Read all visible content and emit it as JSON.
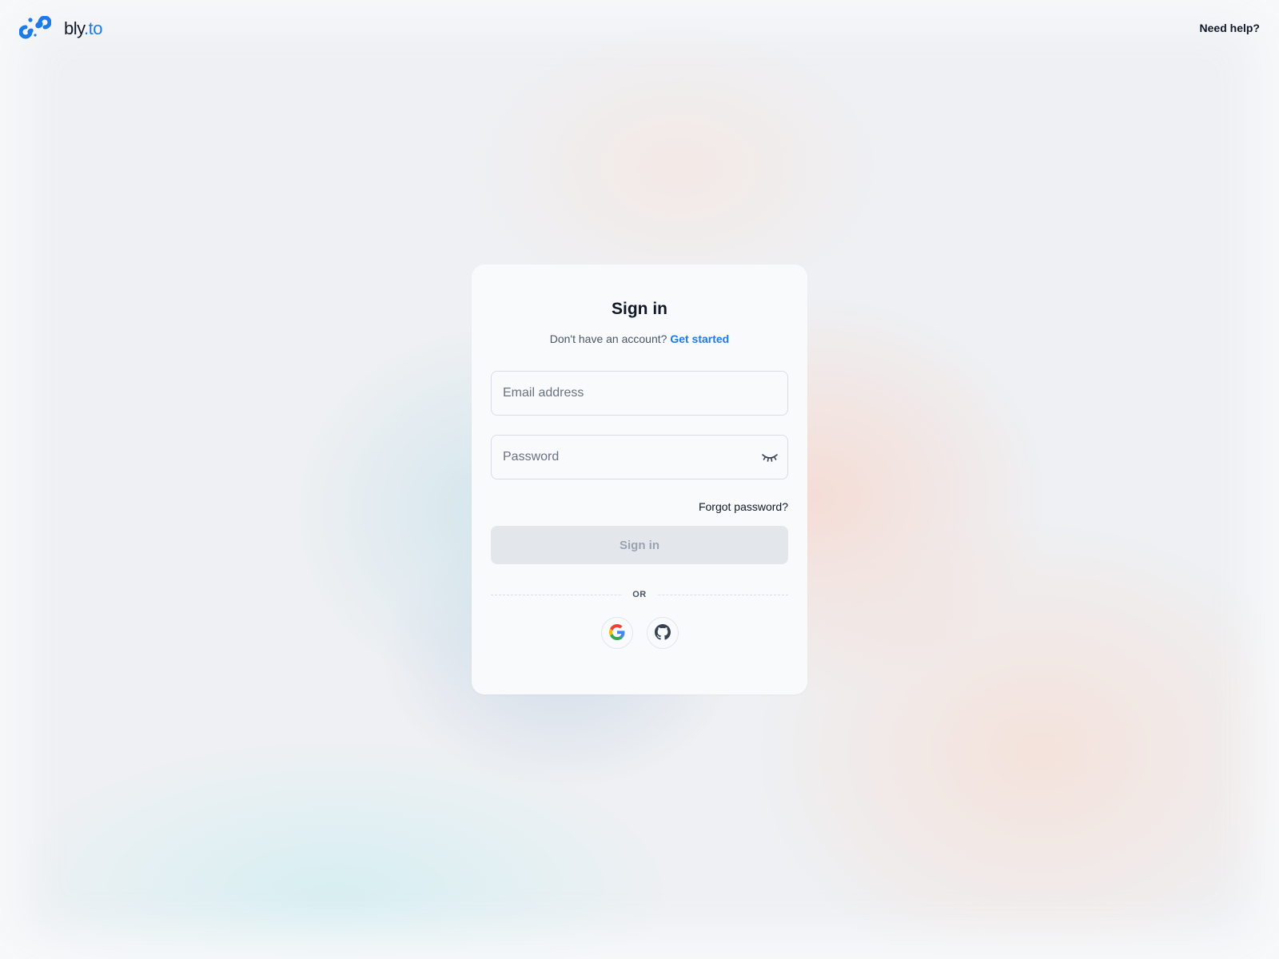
{
  "header": {
    "brand": {
      "name_part1": "bly",
      "name_part2": ".to",
      "logo_icon": "chain-link-icon"
    },
    "help_link": "Need help?"
  },
  "card": {
    "title": "Sign in",
    "subtitle_prefix": "Don't have an account?",
    "subtitle_link": "Get started",
    "email": {
      "placeholder": "Email address",
      "value": ""
    },
    "password": {
      "placeholder": "Password",
      "value": "",
      "toggle_icon": "eye-closed-icon"
    },
    "forgot_password": "Forgot password?",
    "submit_label": "Sign in",
    "divider_label": "OR",
    "social": [
      {
        "provider": "Google",
        "icon": "google-icon"
      },
      {
        "provider": "GitHub",
        "icon": "github-icon"
      }
    ]
  },
  "colors": {
    "accent": "#1e7be6",
    "card_background": "#f8fafc",
    "disabled_button": "#e3e6eb",
    "disabled_button_text": "#9aa3b2"
  }
}
